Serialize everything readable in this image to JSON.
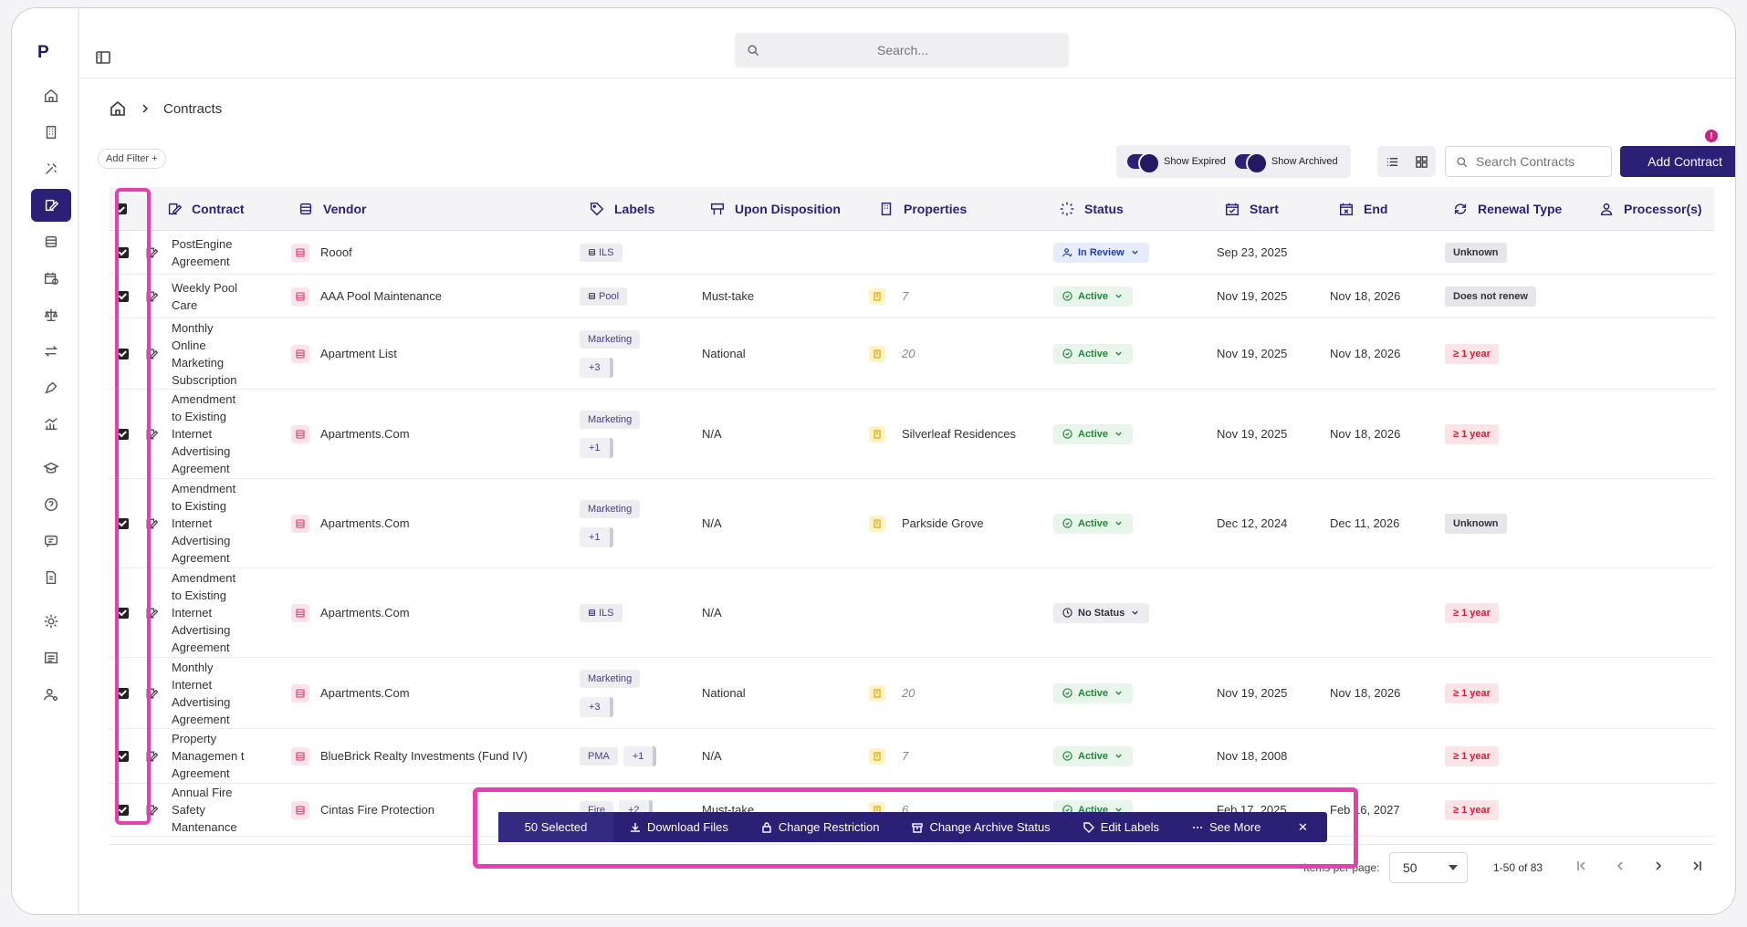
{
  "app": {
    "logo": "P"
  },
  "search": {
    "placeholder": "Search..."
  },
  "breadcrumb": {
    "current": "Contracts"
  },
  "toolbar": {
    "add_filter": "Add Filter +",
    "show_expired": "Show Expired",
    "show_archived": "Show Archived",
    "search_placeholder": "Search Contracts",
    "add_contract": "Add Contract",
    "info": "!"
  },
  "columns": [
    "Contract",
    "Vendor",
    "Labels",
    "Upon Disposition",
    "Properties",
    "Status",
    "Start",
    "End",
    "Renewal Type",
    "Processor(s)"
  ],
  "rows": [
    {
      "contract": "PostEngine Agreement",
      "vendor": "Rooof",
      "labels": [
        "ILS"
      ],
      "label_icon": true,
      "more": "",
      "disposition": "",
      "property": "",
      "prop_count": "",
      "status": "In Review",
      "status_kind": "review",
      "start": "Sep 23, 2025",
      "end": "",
      "renewal": "Unknown",
      "renewal_kind": "gray"
    },
    {
      "contract": "Weekly Pool Care",
      "vendor": "AAA Pool Maintenance",
      "labels": [
        "Pool"
      ],
      "label_icon": true,
      "more": "",
      "disposition": "Must-take",
      "property": "",
      "prop_count": "7",
      "status": "Active",
      "status_kind": "active",
      "start": "Nov 19, 2025",
      "end": "Nov 18, 2026",
      "renewal": "Does not renew",
      "renewal_kind": "gray"
    },
    {
      "contract": "Monthly Online Marketing Subscription",
      "vendor": "Apartment List",
      "labels": [
        "Marketing"
      ],
      "label_icon": false,
      "more": "+3",
      "stack": true,
      "disposition": "National",
      "property": "",
      "prop_count": "20",
      "status": "Active",
      "status_kind": "active",
      "start": "Nov 19, 2025",
      "end": "Nov 18, 2026",
      "renewal": "≥ 1 year",
      "renewal_kind": "red"
    },
    {
      "contract": "Amendment to Existing Internet Advertising Agreement",
      "vendor": "Apartments.Com",
      "labels": [
        "Marketing"
      ],
      "label_icon": false,
      "more": "+1",
      "stack": true,
      "disposition": "N/A",
      "property": "Silverleaf Residences",
      "prop_count": "",
      "status": "Active",
      "status_kind": "active",
      "start": "Nov 19, 2025",
      "end": "Nov 18, 2026",
      "renewal": "≥ 1 year",
      "renewal_kind": "red"
    },
    {
      "contract": "Amendment to Existing Internet Advertising Agreement",
      "vendor": "Apartments.Com",
      "labels": [
        "Marketing"
      ],
      "label_icon": false,
      "more": "+1",
      "stack": true,
      "disposition": "N/A",
      "property": "Parkside Grove",
      "prop_count": "",
      "status": "Active",
      "status_kind": "active",
      "start": "Dec 12, 2024",
      "end": "Dec 11, 2026",
      "renewal": "Unknown",
      "renewal_kind": "gray"
    },
    {
      "contract": "Amendment to Existing Internet Advertising Agreement",
      "vendor": "Apartments.Com",
      "labels": [
        "ILS"
      ],
      "label_icon": true,
      "more": "",
      "disposition": "N/A",
      "property": "",
      "prop_count": "",
      "status": "No Status",
      "status_kind": "none",
      "start": "",
      "end": "",
      "renewal": "≥ 1 year",
      "renewal_kind": "red"
    },
    {
      "contract": "Monthly Internet Advertising Agreement",
      "vendor": "Apartments.Com",
      "labels": [
        "Marketing"
      ],
      "label_icon": false,
      "more": "+3",
      "stack": true,
      "disposition": "National",
      "property": "",
      "prop_count": "20",
      "status": "Active",
      "status_kind": "active",
      "start": "Nov 19, 2025",
      "end": "Nov 18, 2026",
      "renewal": "≥ 1 year",
      "renewal_kind": "red"
    },
    {
      "contract": "Property Managemen t Agreement",
      "vendor": "BlueBrick Realty Investments (Fund IV)",
      "labels": [
        "PMA"
      ],
      "label_icon": false,
      "more": "+1",
      "stack": false,
      "disposition": "N/A",
      "property": "",
      "prop_count": "7",
      "status": "Active",
      "status_kind": "active",
      "start": "Nov 18, 2008",
      "end": "",
      "renewal": "≥ 1 year",
      "renewal_kind": "red"
    },
    {
      "contract": "Annual Fire Safety Mantenance",
      "vendor": "Cintas Fire Protection",
      "labels": [
        "Fire"
      ],
      "label_icon": false,
      "more": "+2",
      "stack": false,
      "disposition": "Must-take",
      "property": "",
      "prop_count": "6",
      "status": "Active",
      "status_kind": "active",
      "start": "Feb 17, 2025",
      "end": "Feb 16, 2027",
      "renewal": "≥ 1 year",
      "renewal_kind": "red"
    }
  ],
  "action_bar": {
    "selected": "50 Selected",
    "download": "Download Files",
    "restriction": "Change Restriction",
    "archive": "Change Archive Status",
    "labels": "Edit Labels",
    "more": "See More",
    "close": "✕"
  },
  "footer": {
    "items_per_page_label": "Items per page:",
    "per_page": "50",
    "range": "1-50 of 83"
  },
  "colors": {
    "brand": "#2c1f76",
    "highlight": "#e53fb0",
    "active": "#218838",
    "danger": "#d21f3c"
  }
}
